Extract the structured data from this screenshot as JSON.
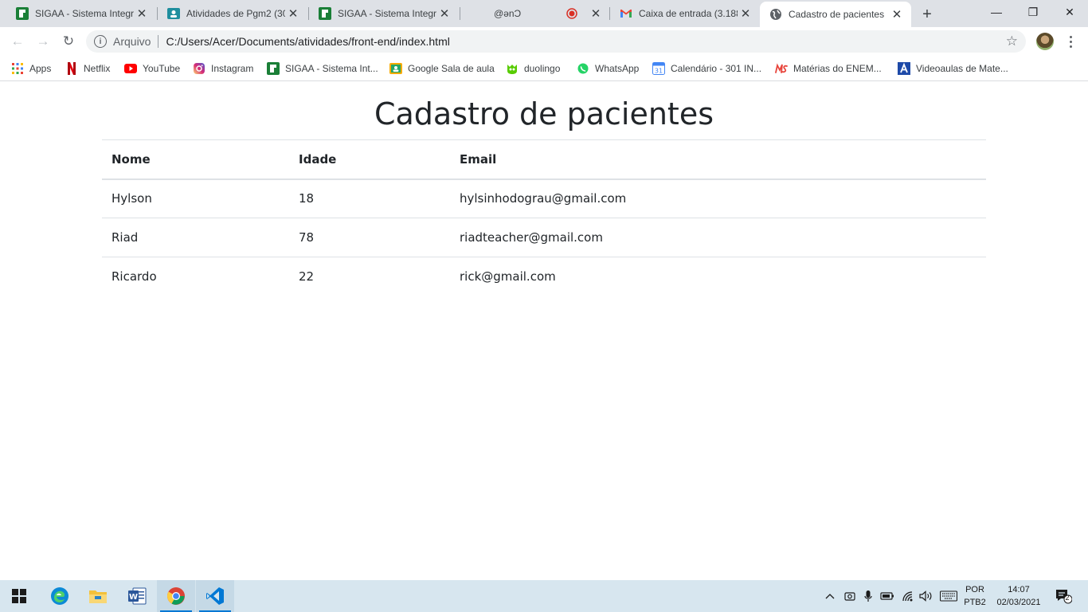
{
  "browser": {
    "tabs": [
      {
        "title": "SIGAA - Sistema Integra",
        "icon": "sigaa-icon"
      },
      {
        "title": "Atividades de Pgm2 (30",
        "icon": "classroom-icon"
      },
      {
        "title": "SIGAA - Sistema Integra",
        "icon": "sigaa-icon"
      },
      {
        "title": "@ənƆ",
        "icon": "recording-icon"
      },
      {
        "title": "Caixa de entrada (3.188",
        "icon": "gmail-icon"
      },
      {
        "title": "Cadastro de pacientes",
        "icon": "globe-icon",
        "active": true
      }
    ],
    "new_tab": "+",
    "window_controls": {
      "minimize": "—",
      "restore": "❐",
      "close": "✕"
    },
    "toolbar": {
      "back": "←",
      "forward": "→",
      "reload": "↻",
      "address_label": "Arquivo",
      "url": "C:/Users/Acer/Documents/atividades/front-end/index.html",
      "bookmark_star": "☆"
    },
    "bookmarks": [
      {
        "label": "Apps",
        "icon": "apps-grid-icon"
      },
      {
        "label": "Netflix",
        "icon": "netflix-icon"
      },
      {
        "label": "YouTube",
        "icon": "youtube-icon"
      },
      {
        "label": "Instagram",
        "icon": "instagram-icon"
      },
      {
        "label": "SIGAA - Sistema Int...",
        "icon": "sigaa-icon"
      },
      {
        "label": "Google Sala de aula",
        "icon": "classroom-icon"
      },
      {
        "label": "duolingo",
        "icon": "duolingo-icon"
      },
      {
        "label": "WhatsApp",
        "icon": "whatsapp-icon"
      },
      {
        "label": "Calendário - 301 IN...",
        "icon": "calendar-icon"
      },
      {
        "label": "Matérias do ENEM...",
        "icon": "ms-icon"
      },
      {
        "label": "Videoaulas de Mate...",
        "icon": "letter-a-icon"
      }
    ]
  },
  "page": {
    "title": "Cadastro de pacientes",
    "table": {
      "headers": [
        "Nome",
        "Idade",
        "Email"
      ],
      "rows": [
        [
          "Hylson",
          "18",
          "hylsinhodograu@gmail.com"
        ],
        [
          "Riad",
          "78",
          "riadteacher@gmail.com"
        ],
        [
          "Ricardo",
          "22",
          "rick@gmail.com"
        ]
      ]
    }
  },
  "taskbar": {
    "apps": [
      "windows-start-icon",
      "edge-icon",
      "file-explorer-icon",
      "word-icon",
      "chrome-icon",
      "vscode-icon"
    ],
    "language": {
      "line1": "POR",
      "line2": "PTB2"
    },
    "time": "14:07",
    "date": "02/03/2021",
    "notification_count": "2"
  },
  "colors": {
    "tabstrip": "#dee1e6",
    "taskbar": "#d7e6ef",
    "page_text": "#212529",
    "table_border": "#dee2e6",
    "vscode_blue": "#0078d4"
  }
}
